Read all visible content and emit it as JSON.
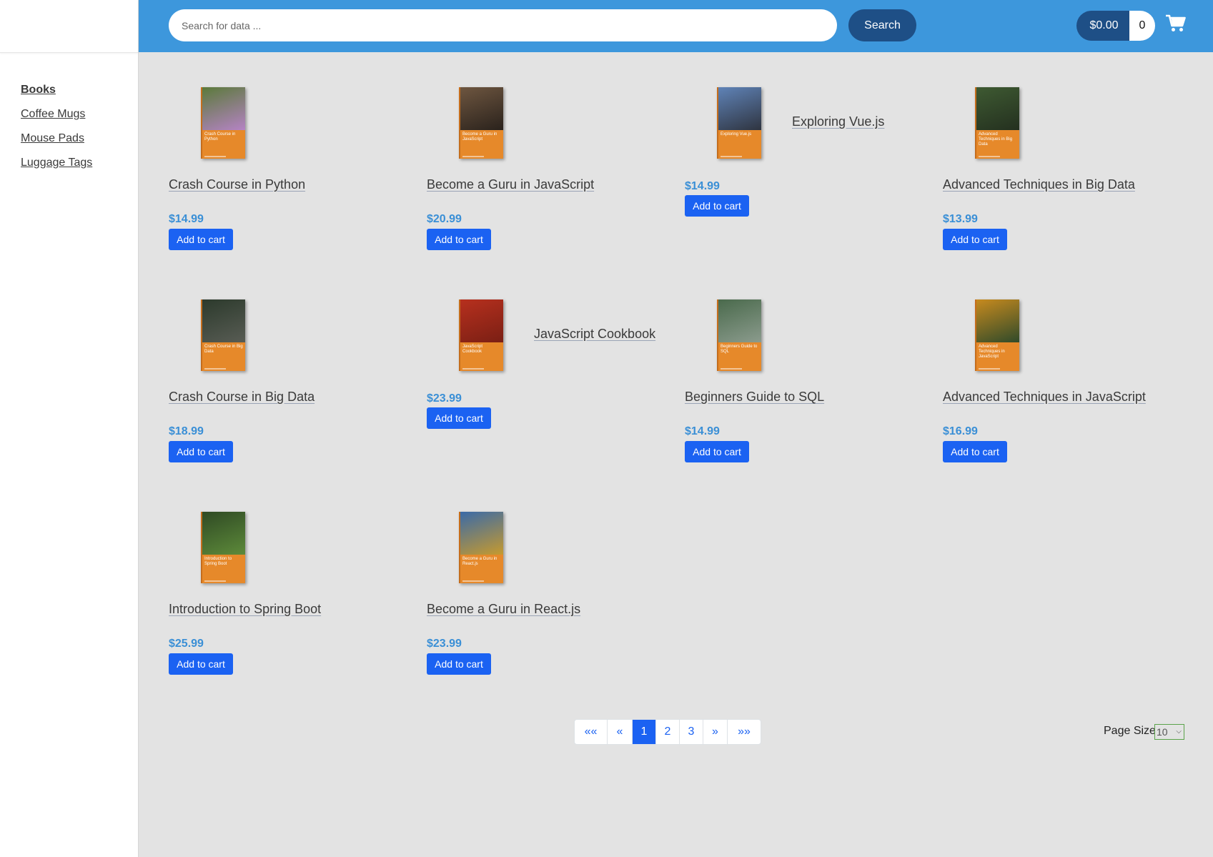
{
  "sidebar": {
    "items": [
      {
        "label": "Books"
      },
      {
        "label": "Coffee Mugs"
      },
      {
        "label": "Mouse Pads"
      },
      {
        "label": "Luggage Tags"
      }
    ]
  },
  "header": {
    "search_placeholder": "Search for data ...",
    "search_label": "Search",
    "cart_total": "$0.00",
    "cart_count": "0"
  },
  "products": [
    {
      "title": "Crash Course in Python",
      "price": "$14.99",
      "cover_text": "Crash Course in Python",
      "photo_colors": [
        "#5a7a3a",
        "#b583c4"
      ],
      "add_label": "Add to cart"
    },
    {
      "title": "Become a Guru in JavaScript",
      "price": "$20.99",
      "cover_text": "Become a Guru in JavaScript",
      "photo_colors": [
        "#6e5640",
        "#2a221c"
      ],
      "add_label": "Add to cart"
    },
    {
      "title": "Exploring Vue.js",
      "price": "$14.99",
      "cover_text": "Exploring Vue.js",
      "photo_colors": [
        "#5f83b7",
        "#2f3440"
      ],
      "add_label": "Add to cart"
    },
    {
      "title": "Advanced Techniques in Big Data",
      "price": "$13.99",
      "cover_text": "Advanced Techniques in Big Data",
      "photo_colors": [
        "#3e5a32",
        "#24301f"
      ],
      "add_label": "Add to cart"
    },
    {
      "title": "Crash Course in Big Data",
      "price": "$18.99",
      "cover_text": "Crash Course in Big Data",
      "photo_colors": [
        "#2c3a2c",
        "#585c54"
      ],
      "add_label": "Add to cart"
    },
    {
      "title": "JavaScript Cookbook",
      "price": "$23.99",
      "cover_text": "JavaScript Cookbook",
      "photo_colors": [
        "#b7301e",
        "#7a1f14"
      ],
      "add_label": "Add to cart"
    },
    {
      "title": "Beginners Guide to SQL",
      "price": "$14.99",
      "cover_text": "Beginners Guide to SQL",
      "photo_colors": [
        "#4a6a4c",
        "#8b9b8d"
      ],
      "add_label": "Add to cart"
    },
    {
      "title": "Advanced Techniques in JavaScript",
      "price": "$16.99",
      "cover_text": "Advanced Techniques in JavaScript",
      "photo_colors": [
        "#c78a1e",
        "#2f4a2a"
      ],
      "add_label": "Add to cart"
    },
    {
      "title": "Introduction to Spring Boot",
      "price": "$25.99",
      "cover_text": "Introduction to Spring Boot",
      "photo_colors": [
        "#2f4a24",
        "#5d8a3a"
      ],
      "add_label": "Add to cart"
    },
    {
      "title": "Become a Guru in React.js",
      "price": "$23.99",
      "cover_text": "Become a Guru in React.js",
      "photo_colors": [
        "#3a6aa8",
        "#c69a2e"
      ],
      "add_label": "Add to cart"
    }
  ],
  "pagination": {
    "first": "««",
    "prev": "«",
    "pages": [
      "1",
      "2",
      "3"
    ],
    "active_page": "1",
    "next": "»",
    "last": "»»"
  },
  "page_size": {
    "label": "Page Size",
    "value": "10"
  },
  "colors": {
    "header_bg": "#3d97dc",
    "brand_dark": "#1e4f86",
    "button_primary": "#1b62f2",
    "price": "#3a8fd6",
    "cover_orange": "#e6892a"
  },
  "icons": {
    "cart": "shopping-cart-icon",
    "select_arrow": "chevron-down-icon"
  }
}
